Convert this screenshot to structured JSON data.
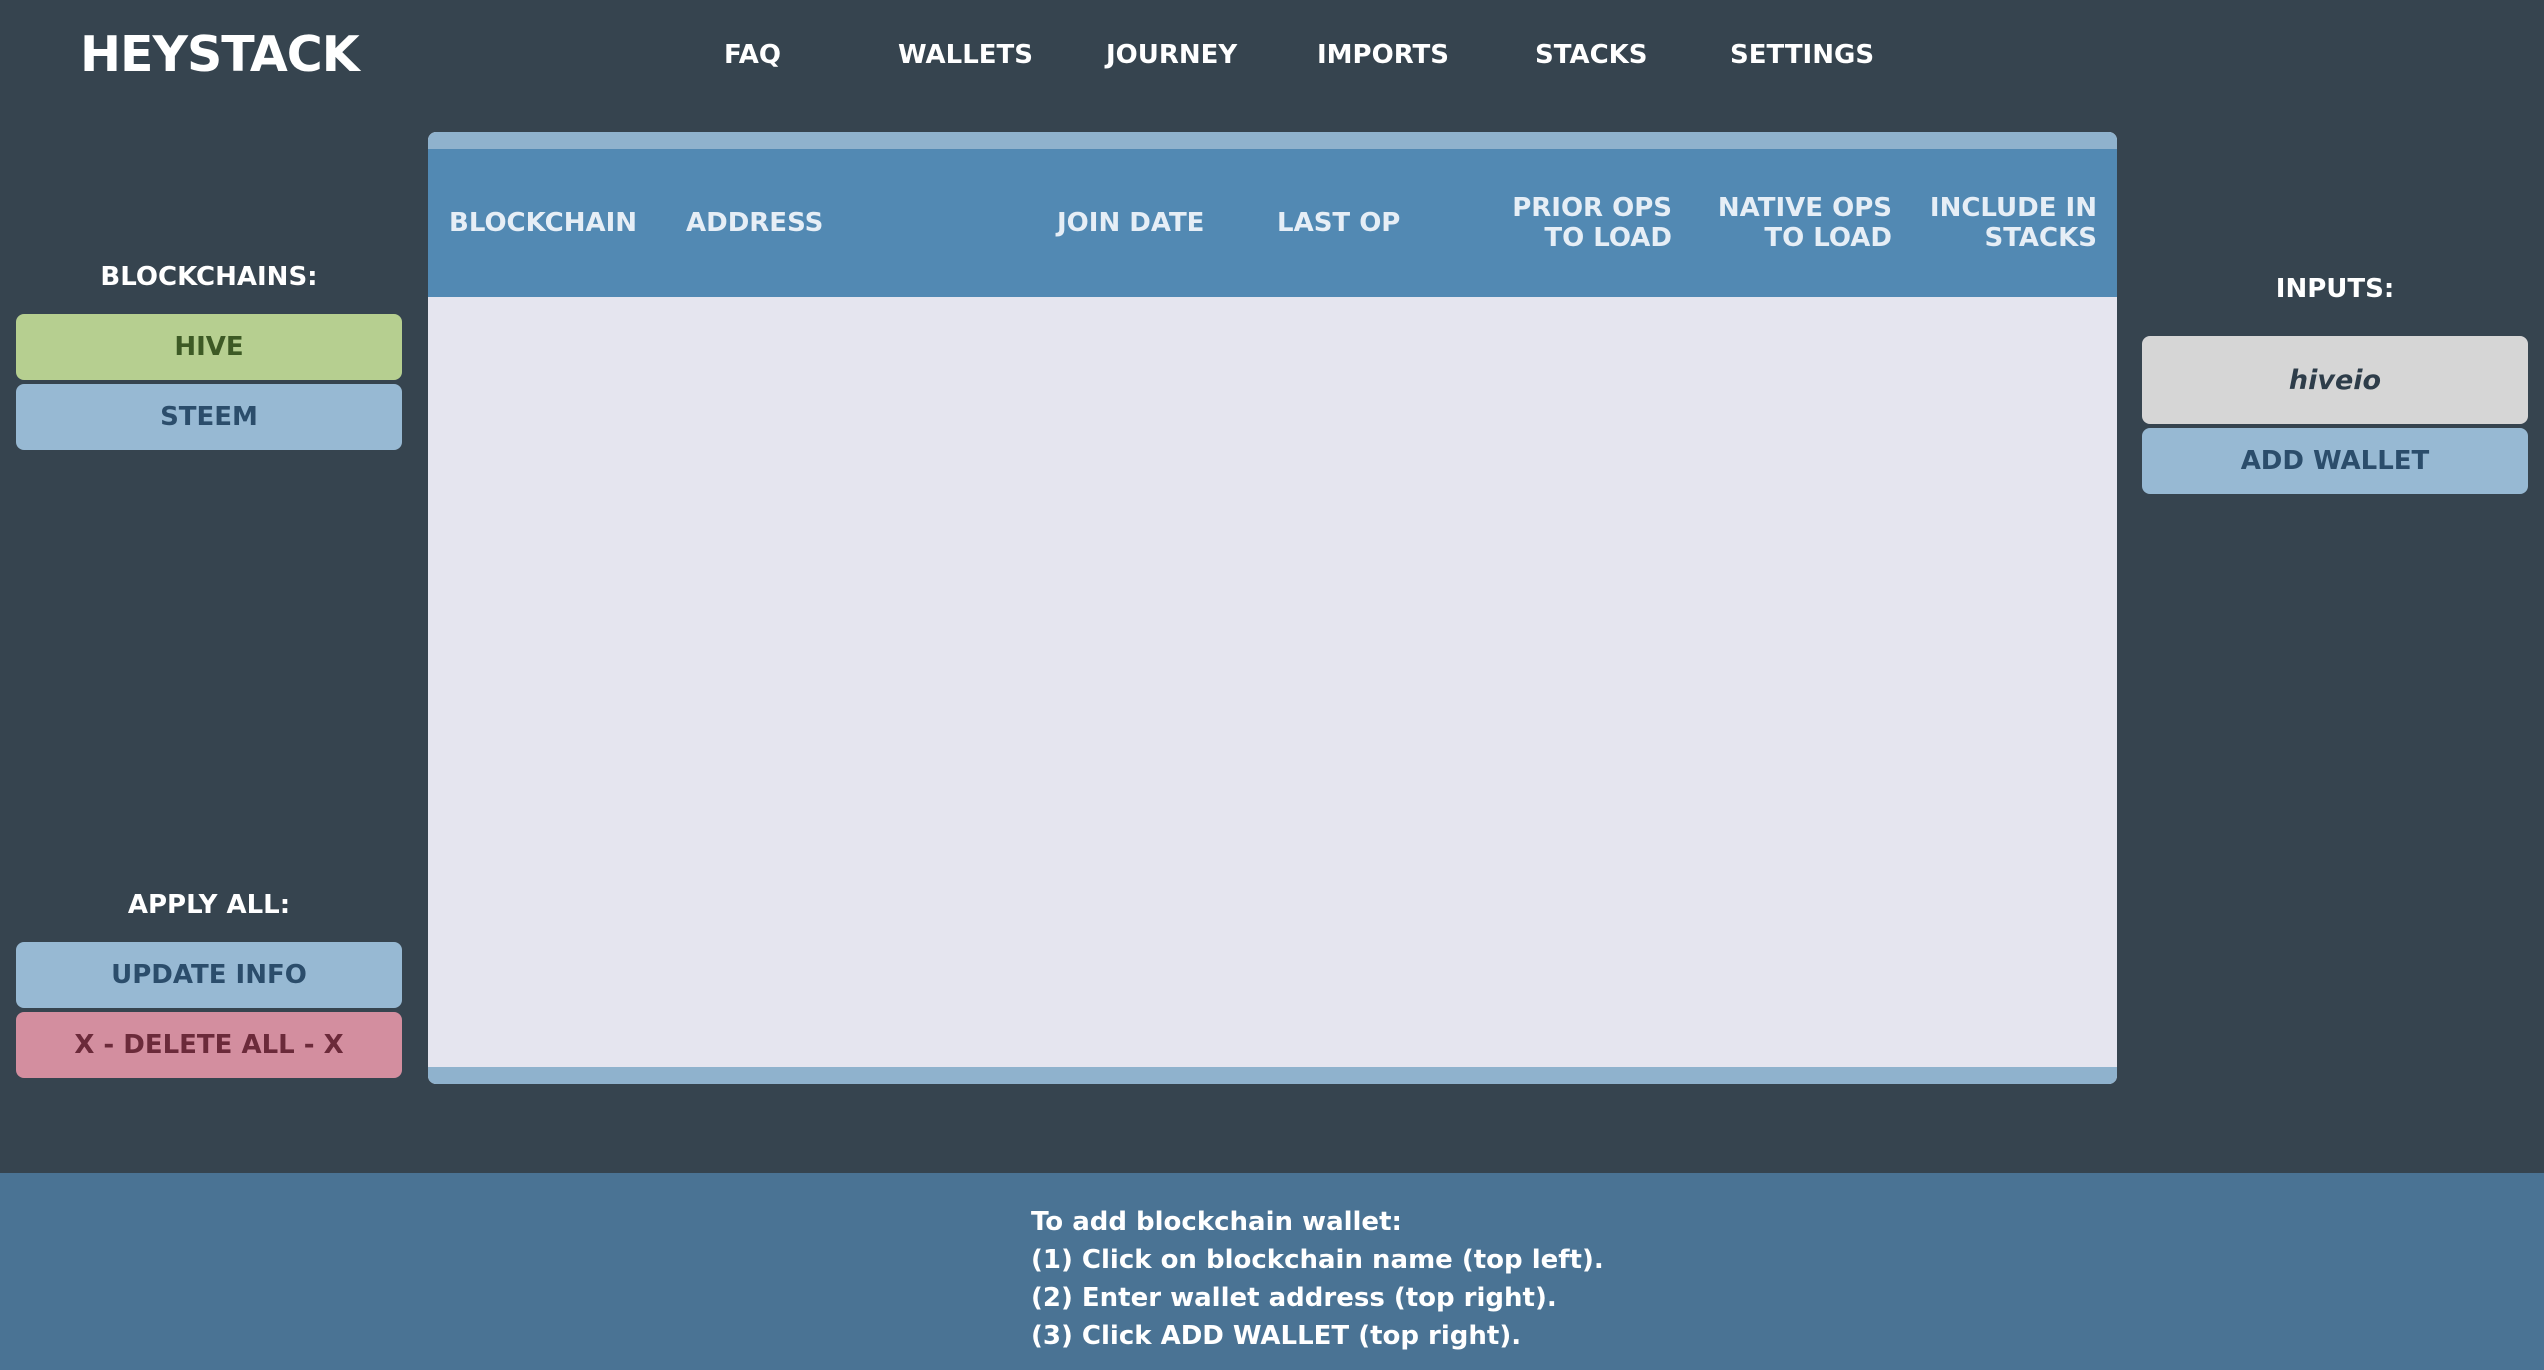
{
  "header": {
    "logo": "HEYSTACK",
    "nav": [
      "FAQ",
      "WALLETS",
      "JOURNEY",
      "IMPORTS",
      "STACKS",
      "SETTINGS"
    ]
  },
  "left_panel": {
    "blockchains_heading": "BLOCKCHAINS:",
    "blockchains": [
      "HIVE",
      "STEEM"
    ],
    "apply_all_heading": "APPLY ALL:",
    "update_label": "UPDATE INFO",
    "delete_label": "X - DELETE ALL - X"
  },
  "table": {
    "columns": [
      {
        "line1": "BLOCKCHAIN",
        "line2": ""
      },
      {
        "line1": "ADDRESS",
        "line2": ""
      },
      {
        "line1": "JOIN DATE",
        "line2": ""
      },
      {
        "line1": "LAST OP",
        "line2": ""
      },
      {
        "line1": "PRIOR OPS",
        "line2": "TO LOAD"
      },
      {
        "line1": "NATIVE OPS",
        "line2": "TO LOAD"
      },
      {
        "line1": "INCLUDE IN",
        "line2": "STACKS"
      }
    ],
    "rows": []
  },
  "right_panel": {
    "inputs_heading": "INPUTS:",
    "wallet_input_value": "hiveio",
    "add_wallet_label": "ADD WALLET"
  },
  "footer": {
    "lines": [
      "To add blockchain wallet:",
      "(1) Click on blockchain name (top left).",
      "(2) Enter wallet address (top right).",
      "(3) Click ADD WALLET (top right)."
    ]
  },
  "colors": {
    "background": "#36444f",
    "hive_button": "#b6cf90",
    "steem_button": "#97b9d3",
    "delete_button": "#d38e9f",
    "table_header": "#5289b3",
    "table_body": "#e5e5ef",
    "footer": "#4a7394"
  }
}
